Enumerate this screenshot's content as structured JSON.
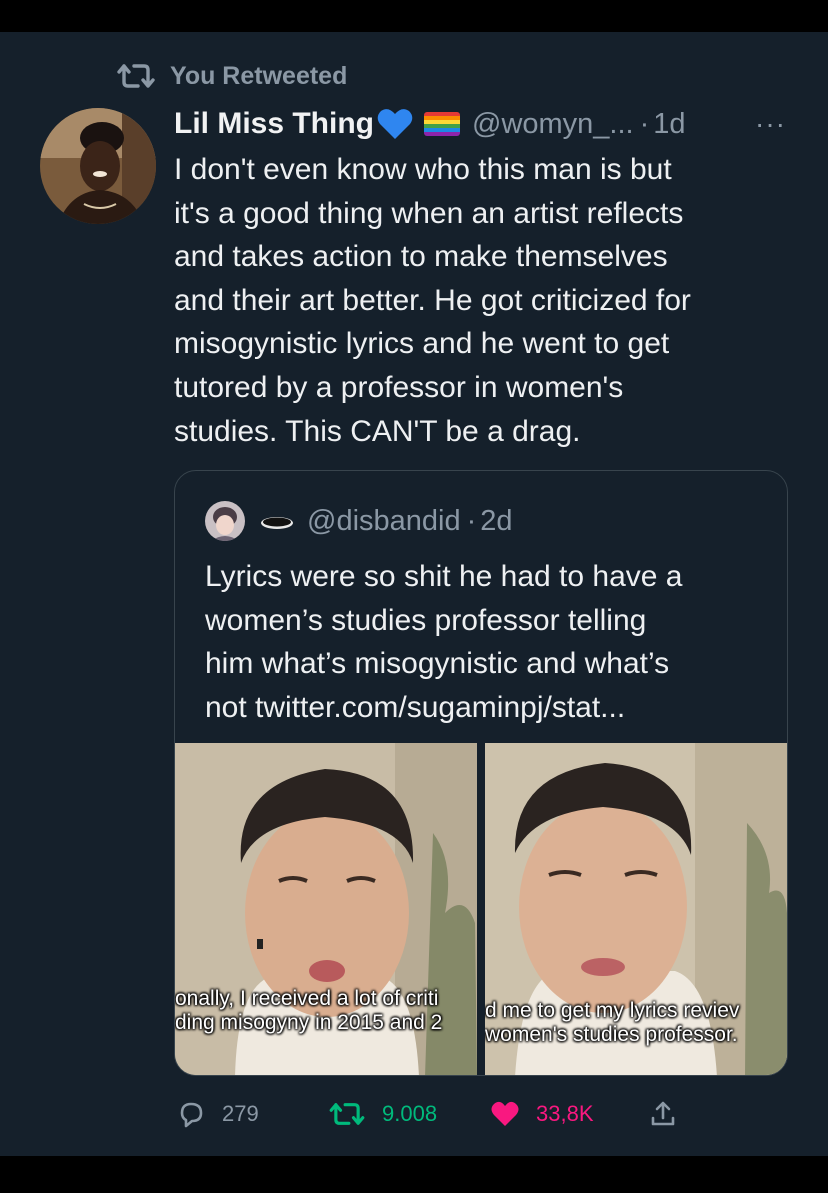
{
  "retweet": {
    "label": "You Retweeted",
    "icon": "retweet-icon"
  },
  "tweet": {
    "author_name": "Lil Miss Thing",
    "badges": [
      "blue-heart-emoji",
      "rainbow-flag-emoji"
    ],
    "handle": "@womyn_...",
    "separator": "·",
    "time": "1d",
    "more_label": "···",
    "text": "I don't even know who this man is but\nit's a good thing when an artist reflects\nand takes action to make themselves\nand their art better. He got criticized for\nmisogynistic lyrics and he went to get\ntutored by a professor in women's\nstudies. This CAN'T be a drag."
  },
  "quoted": {
    "handle": "@disbandid",
    "separator": "·",
    "time": "2d",
    "text": "Lyrics were so shit he had to have a\nwomen’s studies professor telling\nhim what’s misogynistic and what’s\nnot twitter.com/sugaminpj/stat...",
    "media": [
      {
        "caption": "onally, I received a lot of criti\nding misogyny in 2015 and 2"
      },
      {
        "caption": "d me to get my lyrics reviev\nwomen's studies professor."
      }
    ]
  },
  "actions": {
    "reply_count": "279",
    "retweet_count": "9.008",
    "like_count": "33,8K"
  },
  "colors": {
    "background": "#15202b",
    "muted": "#8b98a5",
    "retweet_green": "#00ba7c",
    "like_pink": "#f91880",
    "border": "#38444d"
  }
}
